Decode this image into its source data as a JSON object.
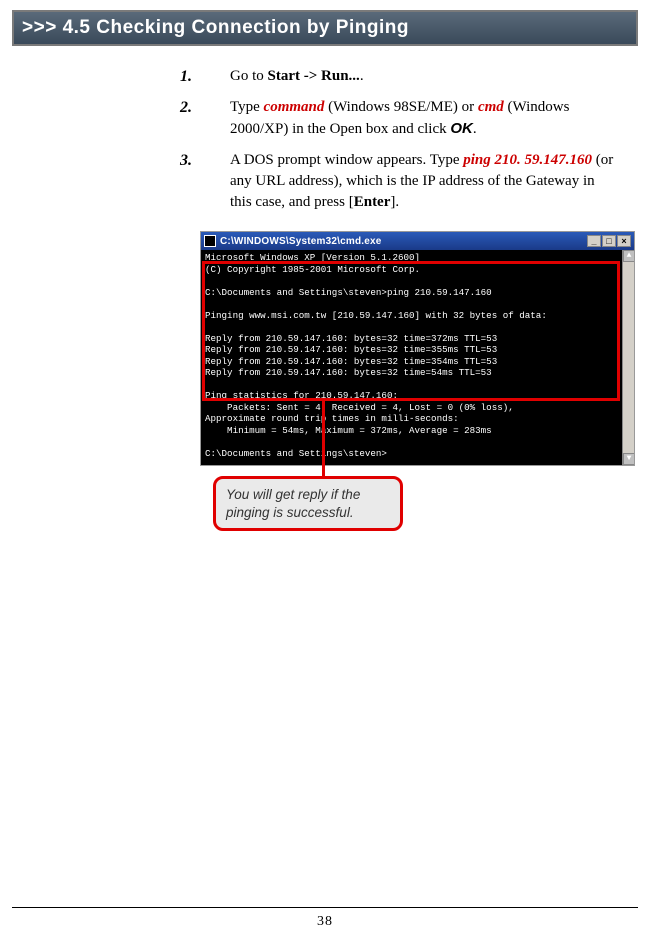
{
  "section_header": ">>> 4.5  Checking Connection by Pinging",
  "steps": [
    {
      "num": "1.",
      "parts": [
        {
          "t": "Go to "
        },
        {
          "t": "Start -> Run...",
          "cls": "bold"
        },
        {
          "t": "."
        }
      ]
    },
    {
      "num": "2.",
      "parts": [
        {
          "t": "Type "
        },
        {
          "t": "command",
          "cls": "cmd-red"
        },
        {
          "t": " (Windows 98SE/ME) or "
        },
        {
          "t": "cmd",
          "cls": "cmd-red"
        },
        {
          "t": " (Windows 2000/XP) in the Open box and click "
        },
        {
          "t": "OK",
          "cls": "ok-text"
        },
        {
          "t": "."
        }
      ]
    },
    {
      "num": "3.",
      "parts": [
        {
          "t": "A DOS prompt window appears.  Type "
        },
        {
          "t": "ping 210. 59.147.160",
          "cls": "cmd-red"
        },
        {
          "t": " (or any URL address), which is the IP address of the Gateway in this case, and press ["
        },
        {
          "t": "Enter",
          "cls": "bold"
        },
        {
          "t": "]."
        }
      ]
    }
  ],
  "cmd_title": "C:\\WINDOWS\\System32\\cmd.exe",
  "cmd_lines": "Microsoft Windows XP [Version 5.1.2600]\n(C) Copyright 1985-2001 Microsoft Corp.\n\nC:\\Documents and Settings\\steven>ping 210.59.147.160\n\nPinging www.msi.com.tw [210.59.147.160] with 32 bytes of data:\n\nReply from 210.59.147.160: bytes=32 time=372ms TTL=53\nReply from 210.59.147.160: bytes=32 time=355ms TTL=53\nReply from 210.59.147.160: bytes=32 time=354ms TTL=53\nReply from 210.59.147.160: bytes=32 time=54ms TTL=53\n\nPing statistics for 210.59.147.160:\n    Packets: Sent = 4, Received = 4, Lost = 0 (0% loss),\nApproximate round trip times in milli-seconds:\n    Minimum = 54ms, Maximum = 372ms, Average = 283ms\n\nC:\\Documents and Settings\\steven>",
  "callout": "You will get reply if the pinging is successful.",
  "page_number": "38",
  "winbtn_min": "_",
  "winbtn_max": "□",
  "winbtn_close": "×"
}
